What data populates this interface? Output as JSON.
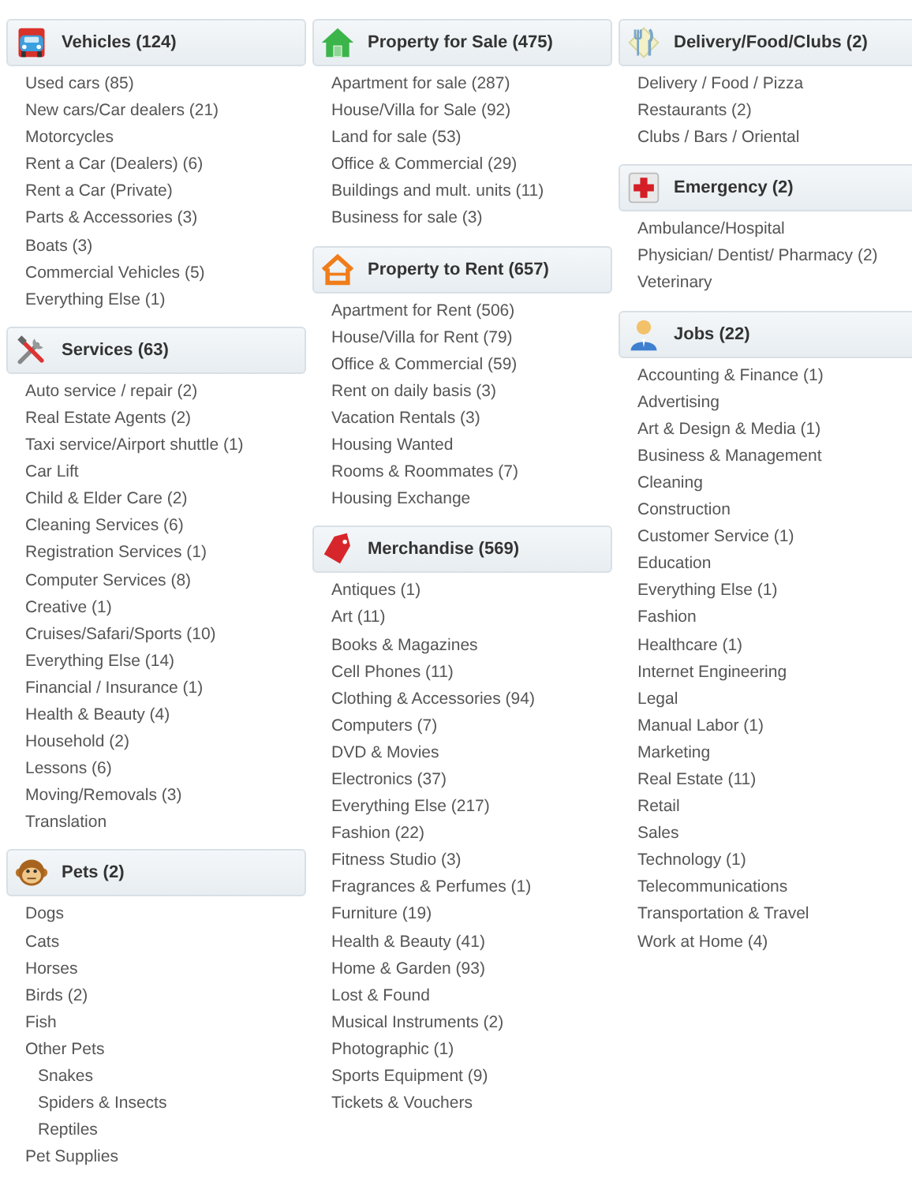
{
  "columns": [
    {
      "sections": [
        {
          "title": "Vehicles (124)",
          "items": [
            {
              "label": "Used cars (85)"
            },
            {
              "label": "New cars/Car dealers (21)"
            },
            {
              "label": "Motorcycles"
            },
            {
              "label": "Rent a Car (Dealers) (6)"
            },
            {
              "label": "Rent a Car (Private)"
            },
            {
              "label": "Parts & Accessories (3)"
            },
            {
              "label": "Boats (3)"
            },
            {
              "label": "Commercial Vehicles (5)"
            },
            {
              "label": "Everything Else (1)"
            }
          ]
        },
        {
          "title": "Services (63)",
          "items": [
            {
              "label": "Auto service / repair (2)"
            },
            {
              "label": "Real Estate Agents (2)"
            },
            {
              "label": "Taxi service/Airport shuttle (1)"
            },
            {
              "label": "Car Lift"
            },
            {
              "label": "Child & Elder Care (2)"
            },
            {
              "label": "Cleaning Services (6)"
            },
            {
              "label": "Registration Services (1)"
            },
            {
              "label": "Computer Services (8)"
            },
            {
              "label": "Creative (1)"
            },
            {
              "label": "Cruises/Safari/Sports (10)"
            },
            {
              "label": "Everything Else (14)"
            },
            {
              "label": "Financial / Insurance (1)"
            },
            {
              "label": "Health & Beauty (4)"
            },
            {
              "label": "Household (2)"
            },
            {
              "label": "Lessons (6)"
            },
            {
              "label": "Moving/Removals (3)"
            },
            {
              "label": "Translation"
            }
          ]
        },
        {
          "title": "Pets (2)",
          "items": [
            {
              "label": "Dogs"
            },
            {
              "label": "Cats"
            },
            {
              "label": "Horses"
            },
            {
              "label": "Birds (2)"
            },
            {
              "label": "Fish"
            },
            {
              "label": "Other Pets",
              "children": [
                {
                  "label": "Snakes"
                },
                {
                  "label": "Spiders & Insects"
                },
                {
                  "label": "Reptiles"
                }
              ]
            },
            {
              "label": "Pet Supplies"
            }
          ]
        }
      ]
    },
    {
      "sections": [
        {
          "title": "Property for Sale (475)",
          "items": [
            {
              "label": "Apartment for sale (287)"
            },
            {
              "label": "House/Villa for Sale (92)"
            },
            {
              "label": "Land for sale (53)"
            },
            {
              "label": "Office & Commercial (29)"
            },
            {
              "label": "Buildings and mult. units (11)"
            },
            {
              "label": "Business for sale (3)"
            }
          ]
        },
        {
          "title": "Property to Rent (657)",
          "items": [
            {
              "label": "Apartment for Rent (506)"
            },
            {
              "label": "House/Villa for Rent (79)"
            },
            {
              "label": "Office & Commercial (59)"
            },
            {
              "label": "Rent on daily basis (3)"
            },
            {
              "label": "Vacation Rentals (3)"
            },
            {
              "label": "Housing Wanted"
            },
            {
              "label": "Rooms & Roommates (7)"
            },
            {
              "label": "Housing Exchange"
            }
          ]
        },
        {
          "title": "Merchandise (569)",
          "items": [
            {
              "label": "Antiques (1)"
            },
            {
              "label": "Art (11)"
            },
            {
              "label": "Books & Magazines"
            },
            {
              "label": "Cell Phones (11)"
            },
            {
              "label": "Clothing & Accessories (94)"
            },
            {
              "label": "Computers (7)"
            },
            {
              "label": "DVD & Movies"
            },
            {
              "label": "Electronics (37)"
            },
            {
              "label": "Everything Else (217)"
            },
            {
              "label": "Fashion (22)"
            },
            {
              "label": "Fitness Studio (3)"
            },
            {
              "label": "Fragrances & Perfumes (1)"
            },
            {
              "label": "Furniture (19)"
            },
            {
              "label": "Health & Beauty (41)"
            },
            {
              "label": "Home & Garden (93)"
            },
            {
              "label": "Lost & Found"
            },
            {
              "label": "Musical Instruments (2)"
            },
            {
              "label": "Photographic (1)"
            },
            {
              "label": "Sports Equipment (9)"
            },
            {
              "label": "Tickets & Vouchers"
            }
          ]
        }
      ]
    },
    {
      "sections": [
        {
          "title": "Delivery/Food/Clubs (2)",
          "items": [
            {
              "label": "Delivery / Food / Pizza"
            },
            {
              "label": "Restaurants (2)"
            },
            {
              "label": "Clubs / Bars / Oriental"
            }
          ]
        },
        {
          "title": "Emergency (2)",
          "items": [
            {
              "label": "Ambulance/Hospital"
            },
            {
              "label": "Physician/ Dentist/ Pharmacy (2)"
            },
            {
              "label": "Veterinary"
            }
          ]
        },
        {
          "title": "Jobs (22)",
          "items": [
            {
              "label": "Accounting & Finance (1)"
            },
            {
              "label": "Advertising"
            },
            {
              "label": "Art & Design & Media (1)"
            },
            {
              "label": "Business & Management"
            },
            {
              "label": "Cleaning"
            },
            {
              "label": "Construction"
            },
            {
              "label": "Customer Service (1)"
            },
            {
              "label": "Education"
            },
            {
              "label": "Everything Else (1)"
            },
            {
              "label": "Fashion"
            },
            {
              "label": "Healthcare (1)"
            },
            {
              "label": "Internet Engineering"
            },
            {
              "label": "Legal"
            },
            {
              "label": "Manual Labor (1)"
            },
            {
              "label": "Marketing"
            },
            {
              "label": "Real Estate (11)"
            },
            {
              "label": "Retail"
            },
            {
              "label": "Sales"
            },
            {
              "label": "Technology (1)"
            },
            {
              "label": "Telecommunications"
            },
            {
              "label": "Transportation & Travel"
            },
            {
              "label": "Work at Home (4)"
            }
          ]
        }
      ]
    }
  ]
}
